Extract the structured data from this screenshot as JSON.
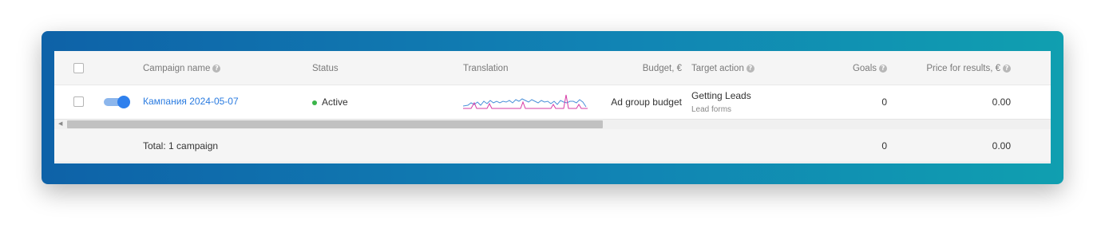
{
  "header": {
    "campaign_name": "Campaign name",
    "status": "Status",
    "translation": "Translation",
    "budget": "Budget, €",
    "target_action": "Target action",
    "goals": "Goals",
    "price_for_results": "Price for results, €"
  },
  "row": {
    "campaign_name": "Кампания 2024-05-07",
    "status": "Active",
    "budget": "Ad group budget",
    "target_action": "Getting Leads",
    "target_action_sub": "Lead forms",
    "goals": "0",
    "price_for_results": "0.00",
    "toggle_on": true
  },
  "total": {
    "label": "Total: 1 campaign",
    "goals": "0",
    "price_for_results": "0.00"
  },
  "icons": {
    "help": "question-circle-icon",
    "scroll_left": "caret-left-icon"
  },
  "colors": {
    "accent": "#2f80ed",
    "active_status": "#3bb54a",
    "sparkline_blue": "#4a90d9",
    "sparkline_pink": "#d63ba6"
  }
}
